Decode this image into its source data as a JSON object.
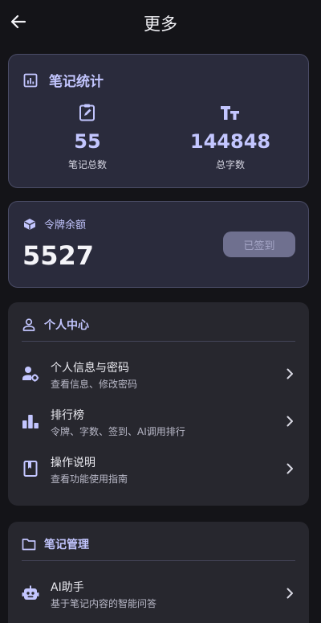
{
  "header": {
    "title": "更多"
  },
  "stats": {
    "title": "笔记统计",
    "notes_count": "55",
    "notes_count_label": "笔记总数",
    "words_count": "144848",
    "words_count_label": "总字数"
  },
  "tokens": {
    "title": "令牌余额",
    "value": "5527",
    "checkin_label": "已签到"
  },
  "personal": {
    "title": "个人中心",
    "items": [
      {
        "title": "个人信息与密码",
        "subtitle": "查看信息、修改密码",
        "icon": "user-settings-icon"
      },
      {
        "title": "排行榜",
        "subtitle": "令牌、字数、签到、AI调用排行",
        "icon": "leaderboard-icon"
      },
      {
        "title": "操作说明",
        "subtitle": "查看功能使用指南",
        "icon": "guide-book-icon"
      }
    ]
  },
  "notes_mgmt": {
    "title": "笔记管理",
    "items": [
      {
        "title": "AI助手",
        "subtitle": "基于笔记内容的智能问答",
        "icon": "robot-icon"
      }
    ]
  },
  "colors": {
    "background": "#141418",
    "accent": "#c3c6ff",
    "card": "#2a2b3c",
    "card_border": "#4a4c66",
    "section_card": "#27272e"
  }
}
